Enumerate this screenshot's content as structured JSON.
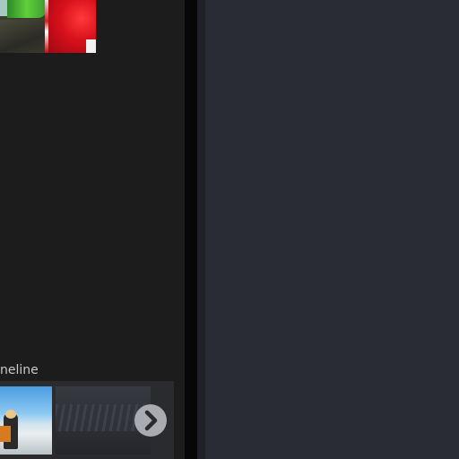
{
  "timeline": {
    "label": "neline"
  },
  "icons": {
    "next": "chevron-right-icon"
  },
  "colors": {
    "left_panel_bg": "#1c1c1c",
    "right_panel_bg": "#292c34",
    "divider": "#070707",
    "arrow_button": "#a9abb0"
  }
}
